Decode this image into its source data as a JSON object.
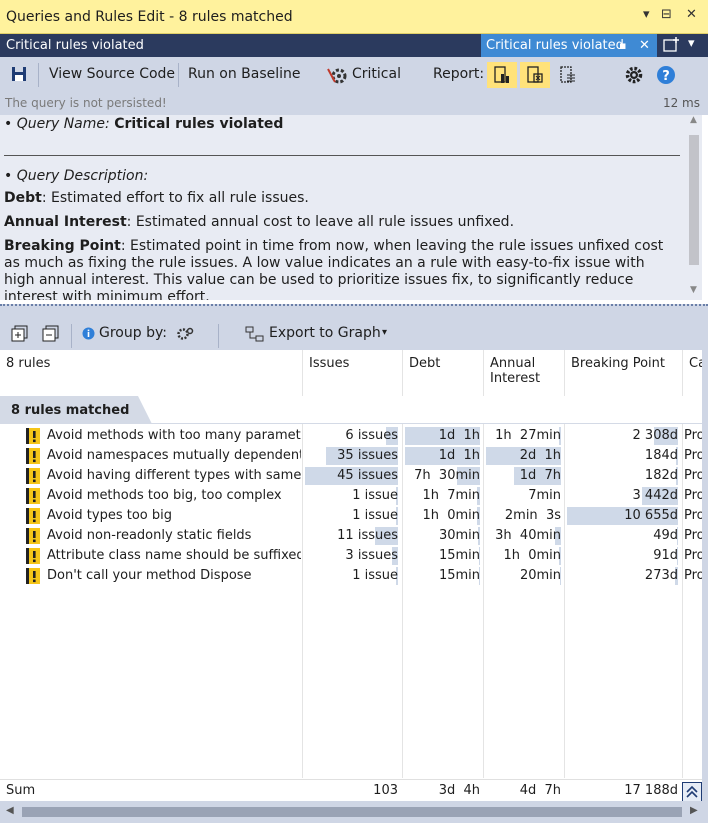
{
  "window": {
    "title": "Queries and Rules Edit  - 8 rules matched",
    "title_buttons": [
      "▾",
      "⊟",
      "✕"
    ]
  },
  "tabbar": {
    "left_label": "Critical rules violated",
    "active_tab": "Critical rules violated",
    "pin_glyph": "▪",
    "close_glyph": "✕",
    "dropdown_glyph": "▾"
  },
  "toolbar": {
    "view_source": "View Source Code",
    "run_on_baseline": "Run on Baseline",
    "critical": "Critical",
    "report": "Report:"
  },
  "status": {
    "message": "The query is not persisted!",
    "duration": "12 ms"
  },
  "description": {
    "name_prefix": "• Query Name: ",
    "name_value": "Critical rules violated",
    "desc_heading": "• Query Description:",
    "debt_term": "Debt",
    "debt_text": ": Estimated effort to fix all rule issues.",
    "interest_term": "Annual Interest",
    "interest_text": ": Estimated annual cost to leave all rule issues unfixed.",
    "bp_term": "Breaking Point",
    "bp_text": ": Estimated point in time from now, when leaving the rule issues unfixed cost as much as fixing the rule issues. A low value indicates an a rule with easy-to-fix issue with high annual interest. This value can be used to prioritize issues fix, to significantly reduce interest with minimum effort."
  },
  "group_toolbar": {
    "group_by": "Group by:",
    "export": "Export to Graph"
  },
  "grid": {
    "columns": [
      "8 rules",
      "Issues",
      "Debt",
      "Annual\nInterest",
      "Breaking Point",
      "Ca"
    ],
    "group_label": "8 rules matched",
    "rows": [
      {
        "name": "Avoid methods with too many parameter",
        "issues": "6 issues",
        "debt": "1d  1h",
        "interest": "1h  27min",
        "bp": "2 308d",
        "cat": "Pro"
      },
      {
        "name": "Avoid namespaces mutually dependent",
        "issues": "35 issues",
        "debt": "1d  1h",
        "interest": "2d  1h",
        "bp": "184d",
        "cat": "Pro"
      },
      {
        "name": "Avoid having different types with same n",
        "issues": "45 issues",
        "debt": "7h  30min",
        "interest": "1d  7h",
        "bp": "182d",
        "cat": "Pro"
      },
      {
        "name": "Avoid methods too big, too complex",
        "issues": "1 issue",
        "debt": "1h  7min",
        "interest": "7min",
        "bp": "3 442d",
        "cat": "Pro"
      },
      {
        "name": "Avoid types too big",
        "issues": "1 issue",
        "debt": "1h  0min",
        "interest": "2min  3s",
        "bp": "10 655d",
        "cat": "Pro"
      },
      {
        "name": "Avoid non-readonly static fields",
        "issues": "11 issues",
        "debt": "30min",
        "interest": "3h  40min",
        "bp": "49d",
        "cat": "Pro"
      },
      {
        "name": "Attribute class name should be suffixed w",
        "issues": "3 issues",
        "debt": "15min",
        "interest": "1h  0min",
        "bp": "91d",
        "cat": "Pro"
      },
      {
        "name": "Don't call your method Dispose",
        "issues": "1 issue",
        "debt": "15min",
        "interest": "20min",
        "bp": "273d",
        "cat": "Pro"
      }
    ],
    "sum": {
      "label": "Sum",
      "issues": "103",
      "debt": "3d  4h",
      "interest": "4d  7h",
      "bp": "17 188d"
    }
  },
  "colors": {
    "title_bg": "#fff29d",
    "tab_bg": "#2b3a5e",
    "active_tab": "#3f8ad4",
    "toolbar_bg": "#cfd6e5",
    "highlight_bar": "#cfd9e8",
    "warning_yellow": "#f5c518"
  },
  "icons": [
    "save-icon",
    "critical-gear-icon",
    "report-html-icon",
    "report-excel-icon",
    "report-text-icon",
    "settings-icon",
    "help-icon",
    "expand-all-icon",
    "collapse-all-icon",
    "info-icon",
    "group-options-icon",
    "export-graph-icon",
    "warning-rule-icon",
    "scroll-to-top-icon"
  ]
}
